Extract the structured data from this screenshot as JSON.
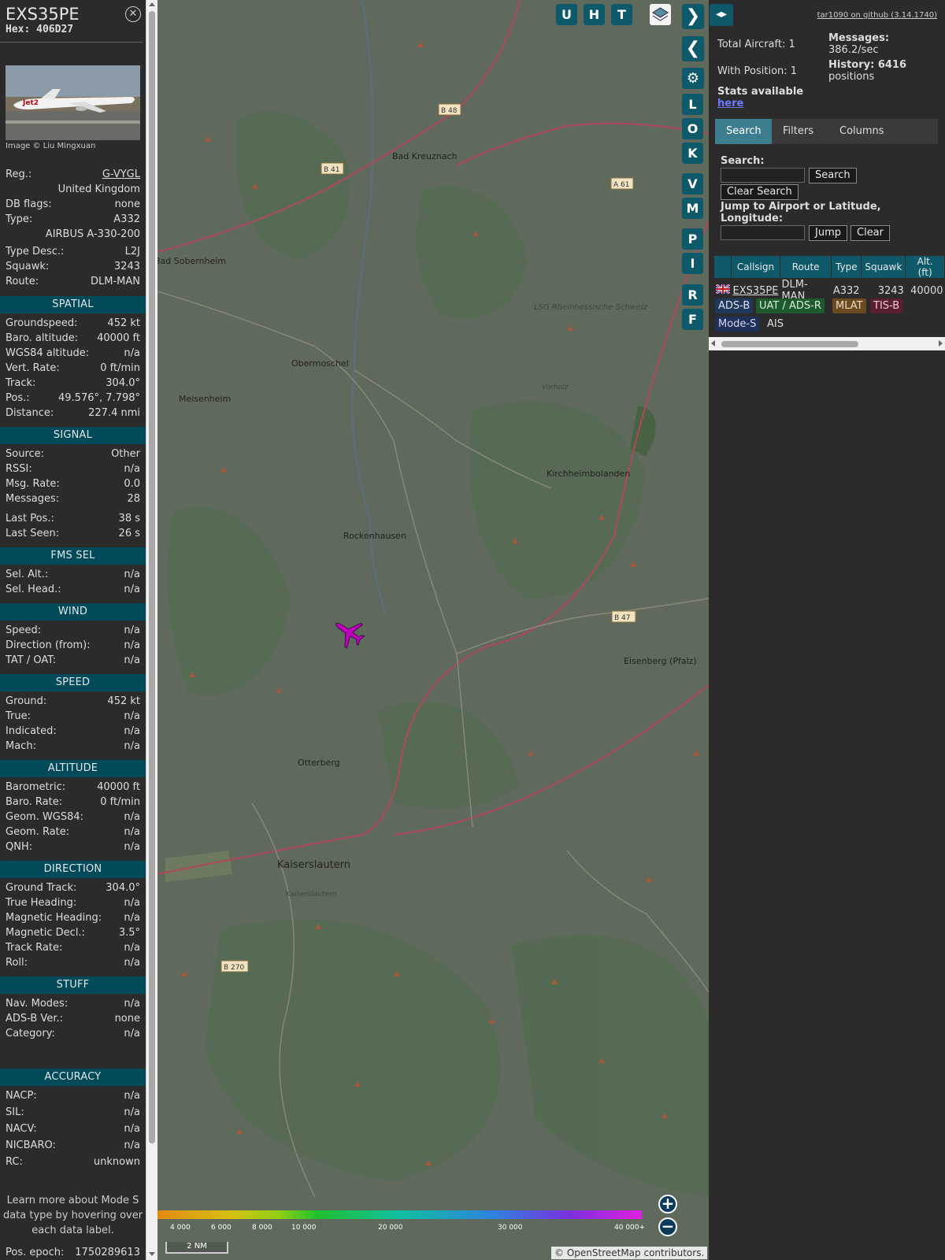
{
  "info": {
    "callsign": "EXS35PE",
    "hex_label": "Hex: 406D27",
    "photo_credit": "Image © Liu Mingxuan",
    "summary": [
      {
        "k": "Reg.:",
        "v": "G-VYGL"
      },
      {
        "k": "",
        "v": "United Kingdom"
      },
      {
        "k": "DB flags:",
        "v": "none"
      },
      {
        "k": "Type:",
        "v": "A332"
      },
      {
        "k": "",
        "v": "AIRBUS A-330-200"
      },
      {
        "k": "Type Desc.:",
        "v": "L2J"
      },
      {
        "k": "Squawk:",
        "v": "3243"
      },
      {
        "k": "Route:",
        "v": "DLM-MAN"
      }
    ],
    "sections": [
      {
        "title": "SPATIAL",
        "rows": [
          {
            "k": "Groundspeed:",
            "v": "452 kt"
          },
          {
            "k": "Baro. altitude:",
            "v": "40000 ft"
          },
          {
            "k": "WGS84 altitude:",
            "v": "n/a"
          },
          {
            "k": "Vert. Rate:",
            "v": "0 ft/min"
          },
          {
            "k": "Track:",
            "v": "304.0°"
          },
          {
            "k": "Pos.:",
            "v": "49.576°, 7.798°"
          },
          {
            "k": "Distance:",
            "v": "227.4 nmi"
          }
        ]
      },
      {
        "title": "SIGNAL",
        "rows": [
          {
            "k": "Source:",
            "v": "Other"
          },
          {
            "k": "RSSI:",
            "v": "n/a"
          },
          {
            "k": "Msg. Rate:",
            "v": "0.0"
          },
          {
            "k": "Messages:",
            "v": "28"
          },
          {
            "k": "Last Pos.:",
            "v": "38 s"
          },
          {
            "k": "Last Seen:",
            "v": "26 s"
          }
        ]
      },
      {
        "title": "FMS SEL",
        "rows": [
          {
            "k": "Sel. Alt.:",
            "v": "n/a"
          },
          {
            "k": "Sel. Head.:",
            "v": "n/a"
          }
        ]
      },
      {
        "title": "WIND",
        "rows": [
          {
            "k": "Speed:",
            "v": "n/a"
          },
          {
            "k": "Direction (from):",
            "v": "n/a"
          },
          {
            "k": "TAT / OAT:",
            "v": "n/a"
          }
        ]
      },
      {
        "title": "SPEED",
        "rows": [
          {
            "k": "Ground:",
            "v": "452 kt"
          },
          {
            "k": "True:",
            "v": "n/a"
          },
          {
            "k": "Indicated:",
            "v": "n/a"
          },
          {
            "k": "Mach:",
            "v": "n/a"
          }
        ]
      },
      {
        "title": "ALTITUDE",
        "rows": [
          {
            "k": "Barometric:",
            "v": "40000 ft"
          },
          {
            "k": "Baro. Rate:",
            "v": "0 ft/min"
          },
          {
            "k": "Geom. WGS84:",
            "v": "n/a"
          },
          {
            "k": "Geom. Rate:",
            "v": "n/a"
          },
          {
            "k": "QNH:",
            "v": "n/a"
          }
        ]
      },
      {
        "title": "DIRECTION",
        "rows": [
          {
            "k": "Ground Track:",
            "v": "304.0°"
          },
          {
            "k": "True Heading:",
            "v": "n/a"
          },
          {
            "k": "Magnetic Heading:",
            "v": "n/a"
          },
          {
            "k": "Magnetic Decl.:",
            "v": "3.5°"
          },
          {
            "k": "Track Rate:",
            "v": "n/a"
          },
          {
            "k": "Roll:",
            "v": "n/a"
          }
        ]
      },
      {
        "title": "STUFF",
        "rows": [
          {
            "k": "Nav. Modes:",
            "v": "n/a"
          },
          {
            "k": "ADS-B Ver.:",
            "v": "none"
          },
          {
            "k": "Category:",
            "v": "n/a"
          }
        ]
      },
      {
        "title": "ACCURACY",
        "rows": [
          {
            "k": "NACP:",
            "v": "n/a"
          },
          {
            "k": "SIL:",
            "v": "n/a"
          },
          {
            "k": "NACV:",
            "v": "n/a"
          },
          {
            "k": "NICBARO:",
            "v": "n/a"
          },
          {
            "k": "RC:",
            "v": "unknown"
          }
        ]
      }
    ],
    "learn_more": "Learn more about Mode S data type by hovering over each data label.",
    "pos_epoch_label": "Pos. epoch:",
    "pos_epoch": "1750289613"
  },
  "map": {
    "top_buttons": [
      "U",
      "H",
      "T"
    ],
    "side_buttons": [
      "L",
      "O",
      "K",
      "V",
      "M",
      "P",
      "I",
      "R",
      "F"
    ],
    "places": [
      "Bad Kreuznach",
      "Obermoschel",
      "Meisenheim",
      "Bad Sobernheim",
      "Rockenhausen",
      "Kirchheimbolanden",
      "Eisenberg (Pfalz)",
      "Otterberg",
      "Kaiserslautern",
      "LSG Rheinhessische Schweiz",
      "Vorholz",
      "Kaiserslautern"
    ],
    "roads": [
      "B 48",
      "B 41",
      "A 61",
      "B 47",
      "B 270"
    ],
    "altitude_legend": [
      "4 000",
      "6 000",
      "8 000",
      "10 000",
      "20 000",
      "30 000",
      "40 000+"
    ],
    "scale_label": "2 NM",
    "attribution": "© OpenStreetMap contributors."
  },
  "right": {
    "github": "tar1090 on github (3.14.1740)",
    "total_aircraft": "Total Aircraft: 1",
    "with_position": "With Position: 1",
    "messages_label": "Messages:",
    "messages_value": "386.2/sec",
    "history_label": "History: 6416",
    "history_value": "positions",
    "stats_label": "Stats available",
    "stats_link": "here",
    "tabs": [
      "Search",
      "Filters",
      "Columns"
    ],
    "search_label": "Search:",
    "search_button": "Search",
    "clear_search_button": "Clear Search",
    "jump_label": "Jump to Airport or Latitude, Longitude:",
    "jump_button": "Jump",
    "clear_button": "Clear",
    "table_headers": [
      "",
      "Callsign",
      "Route",
      "Type",
      "Squawk",
      "Alt. (ft)"
    ],
    "table_rows": [
      {
        "callsign": "EXS35PE",
        "route": "DLM-MAN",
        "type": "A332",
        "squawk": "3243",
        "alt": "40000"
      }
    ],
    "badges": [
      "ADS-B",
      "UAT / ADS-R",
      "MLAT",
      "TIS-B",
      "Mode-S",
      "AIS"
    ]
  },
  "colors": {
    "section_bg": "#004a5a",
    "button_bg": "#0e5a6b",
    "aircraft": "#c000c0",
    "map_bg": "#5f6a5d"
  }
}
